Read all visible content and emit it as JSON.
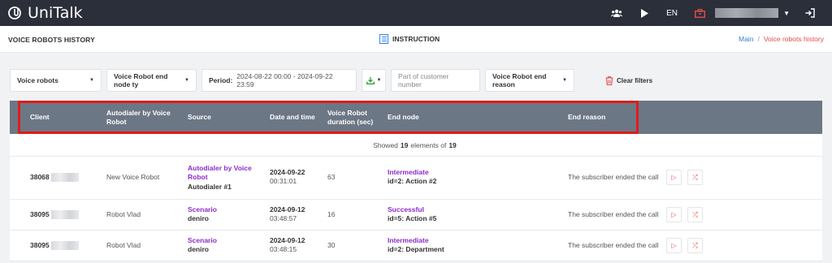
{
  "topbar": {
    "brand": "UniTalk",
    "lang": "EN",
    "icons": [
      "users-icon",
      "play-icon",
      "briefcase-icon",
      "logout-icon"
    ]
  },
  "page": {
    "title": "VOICE ROBOTS HISTORY",
    "instruction": "INSTRUCTION",
    "breadcrumb": {
      "main": "Main",
      "sep": "/",
      "current": "Voice robots history"
    }
  },
  "filters": {
    "voice_robots": "Voice robots",
    "end_node_type": "Voice Robot end node ty",
    "period_label": "Period:",
    "period_value": "2024-08-22 00:00 - 2024-09-22 23:59",
    "customer_placeholder": "Part of customer number",
    "end_reason": "Voice Robot end reason",
    "clear": "Clear filters"
  },
  "table": {
    "headers": {
      "client": "Client",
      "autodialer": "Autodialer by Voice Robot",
      "source": "Source",
      "datetime": "Date and time",
      "duration": "Voice Robot duration (sec)",
      "end_node": "End node",
      "end_reason": "End reason"
    },
    "showed": {
      "prefix": "Showed",
      "count": "19",
      "middle": "elements of",
      "total": "19"
    },
    "rows": [
      {
        "client": "38068",
        "autodialer": "New Voice Robot",
        "source_type": "Autodialer by Voice Robot",
        "source_name": "Autodialer #1",
        "date": "2024-09-22",
        "time": "00:31:01",
        "duration": "63",
        "node_type": "Intermediate",
        "node_id": "id=2: Action #2",
        "end_reason": "The subscriber ended the call"
      },
      {
        "client": "38095",
        "autodialer": "Robot Vlad",
        "source_type": "Scenario",
        "source_name": "deniro",
        "date": "2024-09-12",
        "time": "03:48:57",
        "duration": "16",
        "node_type": "Successful",
        "node_id": "id=5: Action #5",
        "end_reason": "The subscriber ended the call"
      },
      {
        "client": "38095",
        "autodialer": "Robot Vlad",
        "source_type": "Scenario",
        "source_name": "deniro",
        "date": "2024-09-12",
        "time": "03:48:15",
        "duration": "30",
        "node_type": "Intermediate",
        "node_id": "id=2: Department",
        "end_reason": "The subscriber ended the call"
      }
    ]
  },
  "colors": {
    "topbar": "#2b2f3a",
    "header": "#6c7786",
    "accent_red": "#e24c4c",
    "purple": "#8a2cc9",
    "highlight": "#e01b1b"
  }
}
